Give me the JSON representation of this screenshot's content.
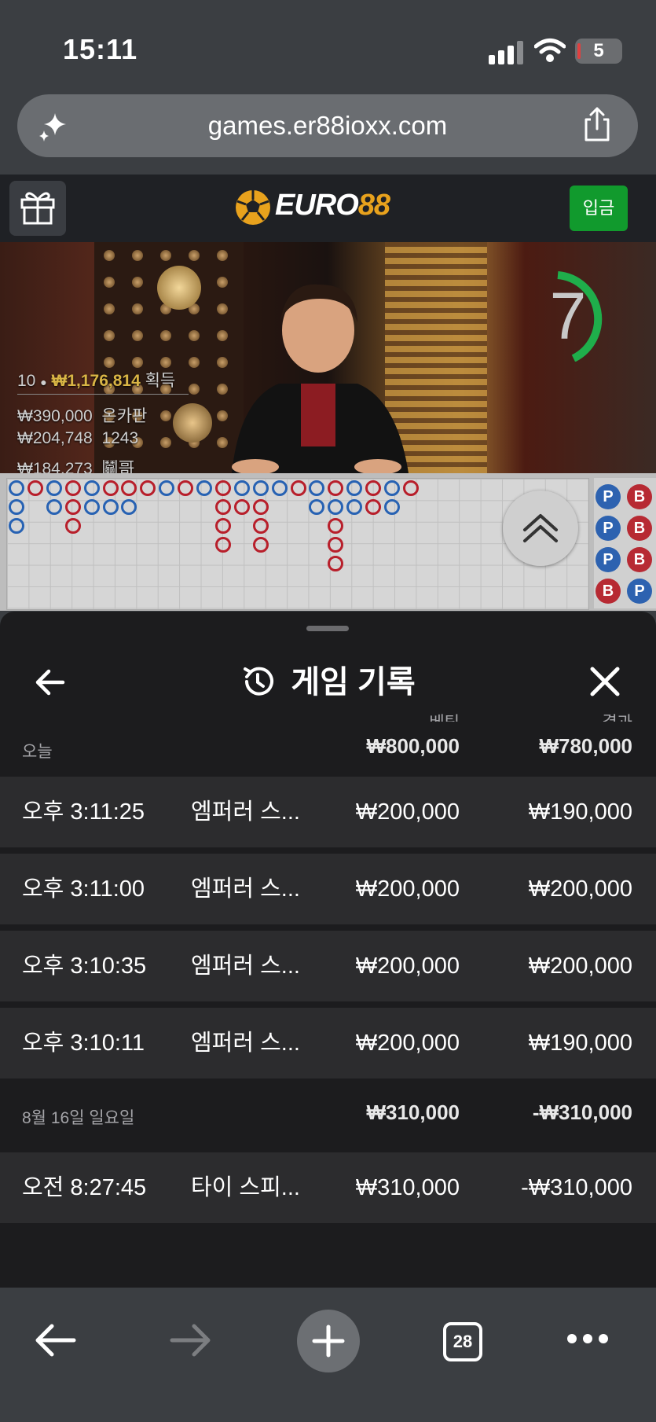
{
  "status_bar": {
    "time": "15:11",
    "battery": "5"
  },
  "url_bar": {
    "url": "games.er88ioxx.com"
  },
  "site_header": {
    "logo_primary": "EURO",
    "logo_accent": "88",
    "deposit_label": "입금"
  },
  "live_video": {
    "timer": "7",
    "players": "10",
    "total_win": "₩1,176,814",
    "win_label": "획득",
    "winners": [
      {
        "amount": "₩390,000",
        "name": "온카판"
      },
      {
        "amount": "₩204,748",
        "name": "1243"
      },
      {
        "amount": "₩184,273",
        "name": "鬮哥"
      }
    ]
  },
  "bead_road": {
    "predictions": [
      [
        "P",
        "B"
      ],
      [
        "P",
        "B"
      ],
      [
        "P",
        "B"
      ],
      [
        "B",
        "P"
      ]
    ],
    "colors": {
      "player": "#2762b3",
      "banker": "#b81f2b"
    }
  },
  "history": {
    "title": "게임 기록",
    "col_bet": "베팅",
    "col_result": "결과",
    "groups": [
      {
        "date": "오늘",
        "total_bet": "₩800,000",
        "total_result": "₩780,000",
        "rows": [
          {
            "time": "오후 3:11:25",
            "game": "엠퍼러 스...",
            "bet": "₩200,000",
            "result": "₩190,000"
          },
          {
            "time": "오후 3:11:00",
            "game": "엠퍼러 스...",
            "bet": "₩200,000",
            "result": "₩200,000"
          },
          {
            "time": "오후 3:10:35",
            "game": "엠퍼러 스...",
            "bet": "₩200,000",
            "result": "₩200,000"
          },
          {
            "time": "오후 3:10:11",
            "game": "엠퍼러 스...",
            "bet": "₩200,000",
            "result": "₩190,000"
          }
        ]
      },
      {
        "date": "8월 16일 일요일",
        "total_bet": "₩310,000",
        "total_result": "-₩310,000",
        "rows": [
          {
            "time": "오전 8:27:45",
            "game": "타이 스피...",
            "bet": "₩310,000",
            "result": "-₩310,000"
          }
        ]
      }
    ]
  },
  "toolbar": {
    "tab_count": "28"
  }
}
